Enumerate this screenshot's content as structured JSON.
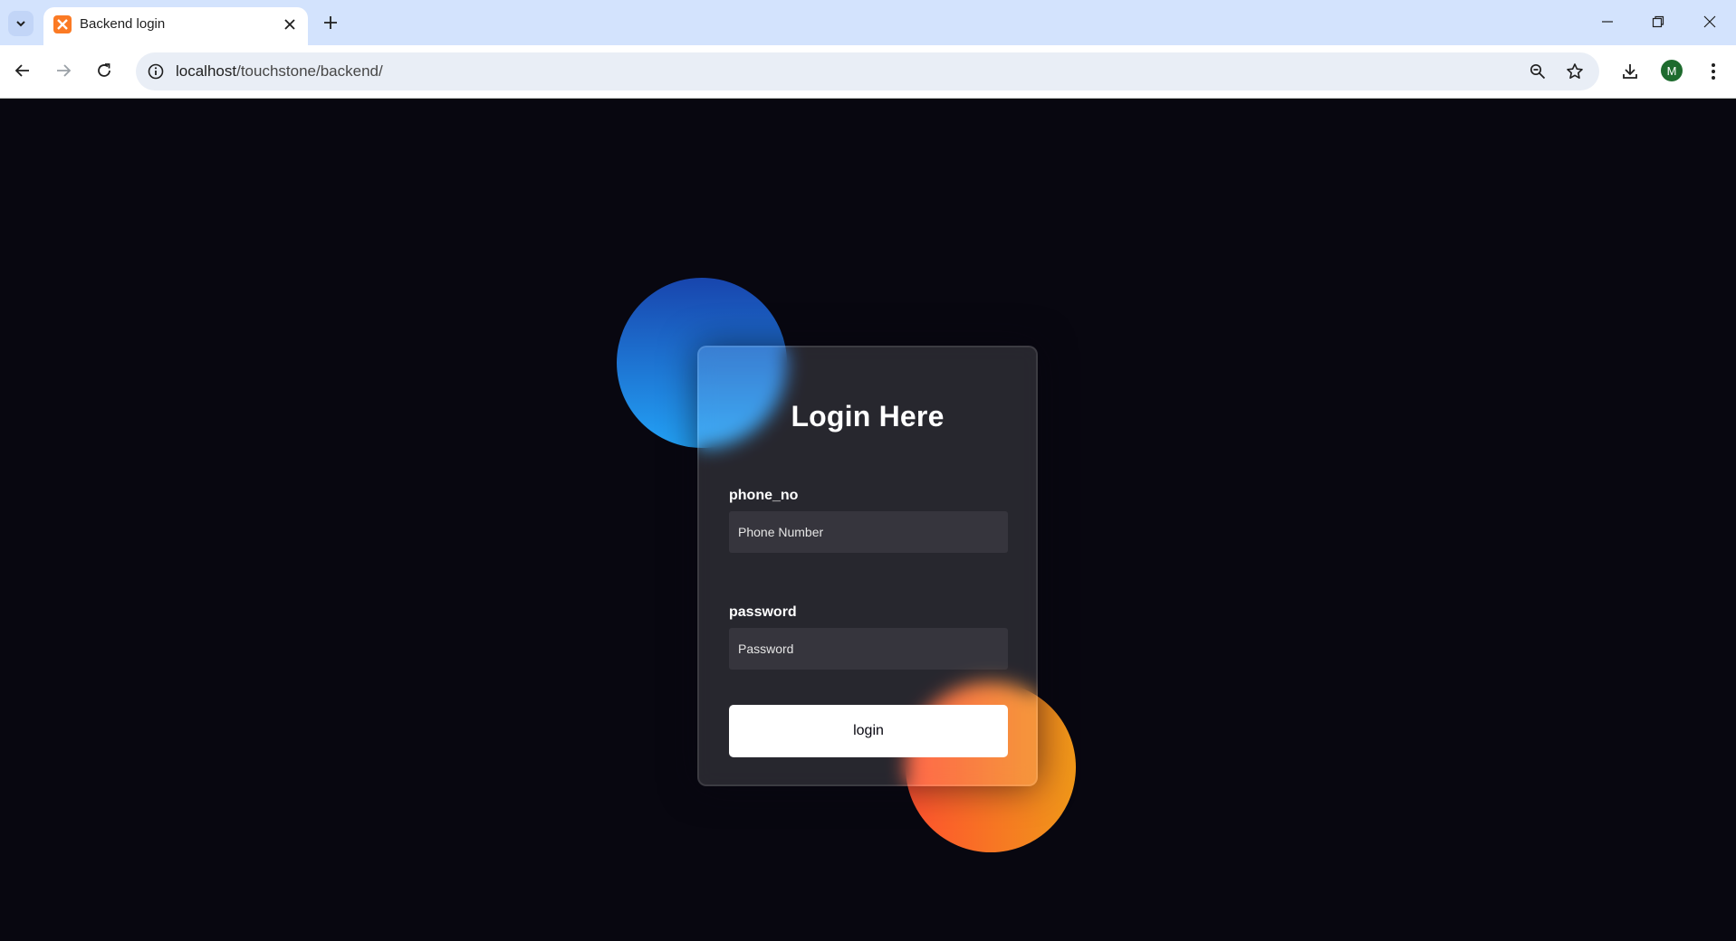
{
  "browser": {
    "tab": {
      "title": "Backend login",
      "favicon": "xampp-favicon-icon"
    },
    "address_bar": {
      "host": "localhost",
      "path": "/touchstone/backend/"
    },
    "profile_initial": "M"
  },
  "login_form": {
    "title": "Login Here",
    "phone": {
      "label": "phone_no",
      "placeholder": "Phone Number",
      "value": ""
    },
    "password": {
      "label": "password",
      "placeholder": "Password",
      "value": ""
    },
    "submit_label": "login"
  },
  "colors": {
    "page_background": "#080710",
    "blue_gradient": [
      "#1845ad",
      "#23a2f6"
    ],
    "orange_gradient": [
      "#ff512f",
      "#f09819"
    ],
    "button_background": "#ffffff"
  }
}
